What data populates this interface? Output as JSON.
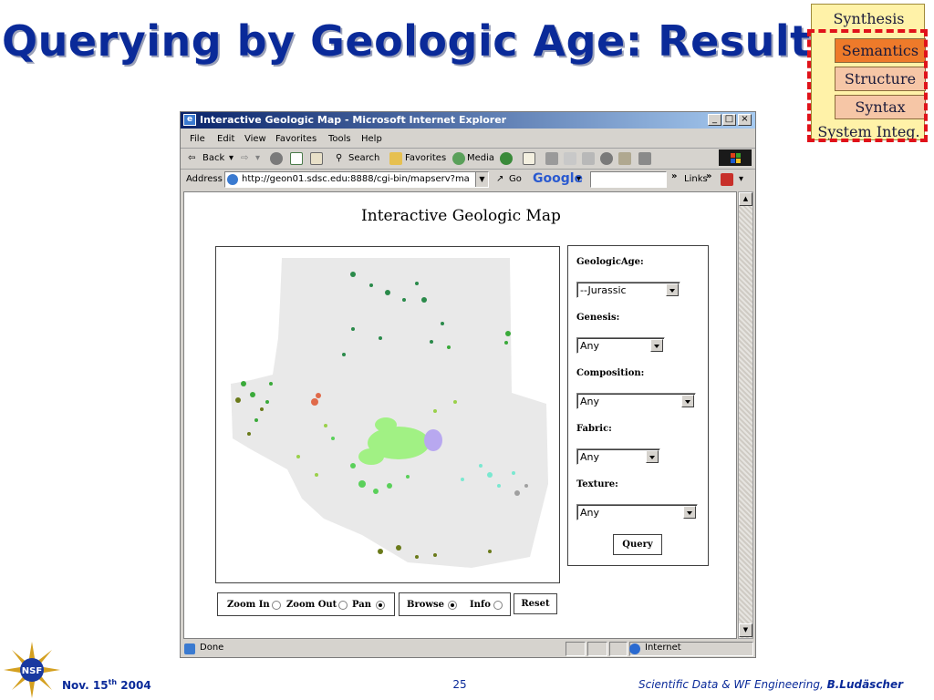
{
  "slide": {
    "title": "Querying by Geologic Age: Results"
  },
  "layer_stack": {
    "synthesis": "Synthesis",
    "semantics": "Semantics",
    "structure": "Structure",
    "syntax": "Syntax",
    "system_integ": "System Integ."
  },
  "browser": {
    "window_title": "Interactive Geologic Map - Microsoft Internet Explorer",
    "menu": [
      "File",
      "Edit",
      "View",
      "Favorites",
      "Tools",
      "Help"
    ],
    "toolbar": {
      "back": "Back",
      "search": "Search",
      "favorites": "Favorites",
      "media": "Media"
    },
    "address_label": "Address",
    "url": "http://geon01.sdsc.edu:8888/cgi-bin/mapserv?map_web_",
    "go": "Go",
    "google": "Google",
    "links": "Links",
    "status": "Done",
    "zone": "Internet"
  },
  "page": {
    "heading": "Interactive Geologic Map",
    "form": {
      "geologic_age_label": "GeologicAge:",
      "geologic_age_value": "--Jurassic",
      "genesis_label": "Genesis:",
      "genesis_value": "Any",
      "composition_label": "Composition:",
      "composition_value": "Any",
      "fabric_label": "Fabric:",
      "fabric_value": "Any",
      "texture_label": "Texture:",
      "texture_value": "Any",
      "query_button": "Query"
    },
    "controls": {
      "zoom_in": "Zoom In",
      "zoom_out": "Zoom Out",
      "pan": "Pan",
      "browse": "Browse",
      "info": "Info",
      "reset": "Reset",
      "selected_nav": "Pan",
      "selected_mode": "Browse"
    }
  },
  "footer": {
    "date_prefix": "Nov. 15",
    "date_sup": "th",
    "date_year": " 2004",
    "page_number": "25",
    "credit": "Scientific Data & WF Engineering, ",
    "author": "B.Ludäscher",
    "logo_text": "NSF"
  },
  "colors": {
    "title": "#0a2a99",
    "semantics_box": "#ee7a2a",
    "layer_box": "#f6c6a6",
    "stack_bg": "#fff2a8",
    "dashed_outline": "#e0121a"
  }
}
